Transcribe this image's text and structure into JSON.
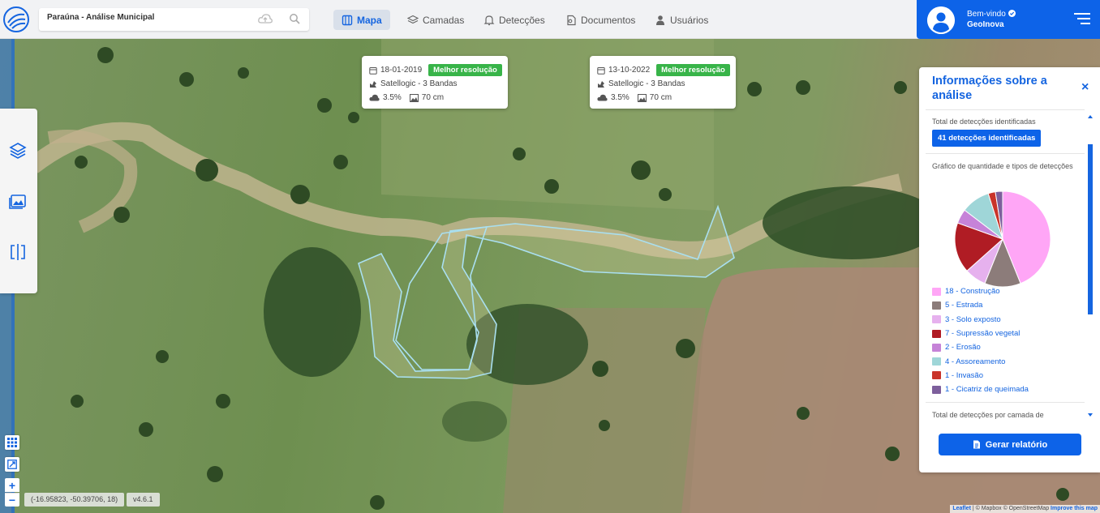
{
  "search": {
    "value": "Paraúna - Análise Municipal",
    "upload_icon": "cloud-upload-icon",
    "search_icon": "search-icon"
  },
  "nav": [
    {
      "label": "Mapa",
      "icon": "map-icon",
      "active": true
    },
    {
      "label": "Camadas",
      "icon": "layers-icon",
      "active": false
    },
    {
      "label": "Detecções",
      "icon": "bell-icon",
      "active": false
    },
    {
      "label": "Documentos",
      "icon": "document-icon",
      "active": false
    },
    {
      "label": "Usuários",
      "icon": "user-icon",
      "active": false
    }
  ],
  "user": {
    "welcome": "Bem-vindo",
    "name": "GeoInova"
  },
  "cards": [
    {
      "date": "18-01-2019",
      "badge": "Melhor resolução",
      "satellite": "Satellogic - 3 Bandas",
      "cloud": "3.5%",
      "resolution": "70 cm"
    },
    {
      "date": "13-10-2022",
      "badge": "Melhor resolução",
      "satellite": "Satellogic - 3 Bandas",
      "cloud": "3.5%",
      "resolution": "70 cm"
    }
  ],
  "map": {
    "coords": "(-16.95823, -50.39706, 18)",
    "version": "v4.6.1",
    "attribution_leaflet": "Leaflet",
    "attribution_rest": " | © Mapbox © OpenStreetMap ",
    "attribution_improve": "Improve this map",
    "zoom_in": "+",
    "zoom_out": "−"
  },
  "panel": {
    "title": "Informações sobre a análise",
    "close": "×",
    "total_label": "Total de detecções identificadas",
    "total_badge": "41 detecções identificadas",
    "chart_label": "Gráfico de quantidade e tipos de detecções",
    "bottom_label": "Total de detecções por camada de",
    "report_button": "Gerar relatório"
  },
  "chart_data": {
    "type": "pie",
    "categories": [
      "Construção",
      "Estrada",
      "Solo exposto",
      "Supressão vegetal",
      "Erosão",
      "Assoreamento",
      "Invasão",
      "Cicatriz de queimada"
    ],
    "values": [
      18,
      5,
      3,
      7,
      2,
      4,
      1,
      1
    ],
    "legend": [
      "18 - Construção",
      "5 - Estrada",
      "3 - Solo exposto",
      "7 - Supressão vegetal",
      "2 - Erosão",
      "4 - Assoreamento",
      "1 - Invasão",
      "1 - Cicatriz de queimada"
    ],
    "colors": [
      "#ffa6f6",
      "#8c7c7a",
      "#e6b1ee",
      "#b01c24",
      "#c683d8",
      "#9fd6d8",
      "#c9342a",
      "#7d5f9c"
    ]
  }
}
